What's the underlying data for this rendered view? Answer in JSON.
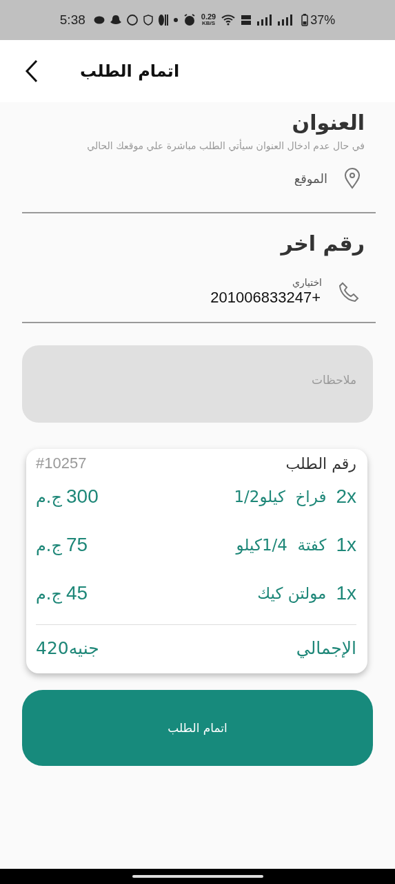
{
  "status_bar": {
    "time": "5:38",
    "speed": "0.29",
    "speed_unit": "KB/S",
    "battery": "37%"
  },
  "header": {
    "title": "اتمام الطلب"
  },
  "address": {
    "title": "العنوان",
    "hint": "في حال عدم ادخال العنوان سيأتي الطلب مباشرة علي موقعك الحالي",
    "placeholder": "الموقع"
  },
  "phone": {
    "title": "رقم اخر",
    "label": "اختياري",
    "value": "+201006833247"
  },
  "notes": {
    "placeholder": "ملاحظات"
  },
  "order": {
    "title": "رقم الطلب",
    "number": "#10257",
    "items": [
      {
        "qty": "2x",
        "name": "فراخ  كيلو1/2",
        "price": "300",
        "currency": "ج.م"
      },
      {
        "qty": "1x",
        "name": "كفتة  1/4كيلو",
        "price": "75",
        "currency": "ج.م"
      },
      {
        "qty": "1x",
        "name": "مولتن كيك",
        "price": "45",
        "currency": "ج.م"
      }
    ],
    "total_label": "الإجمالي",
    "total": "420جنيه"
  },
  "submit": {
    "label": "اتمام الطلب"
  }
}
